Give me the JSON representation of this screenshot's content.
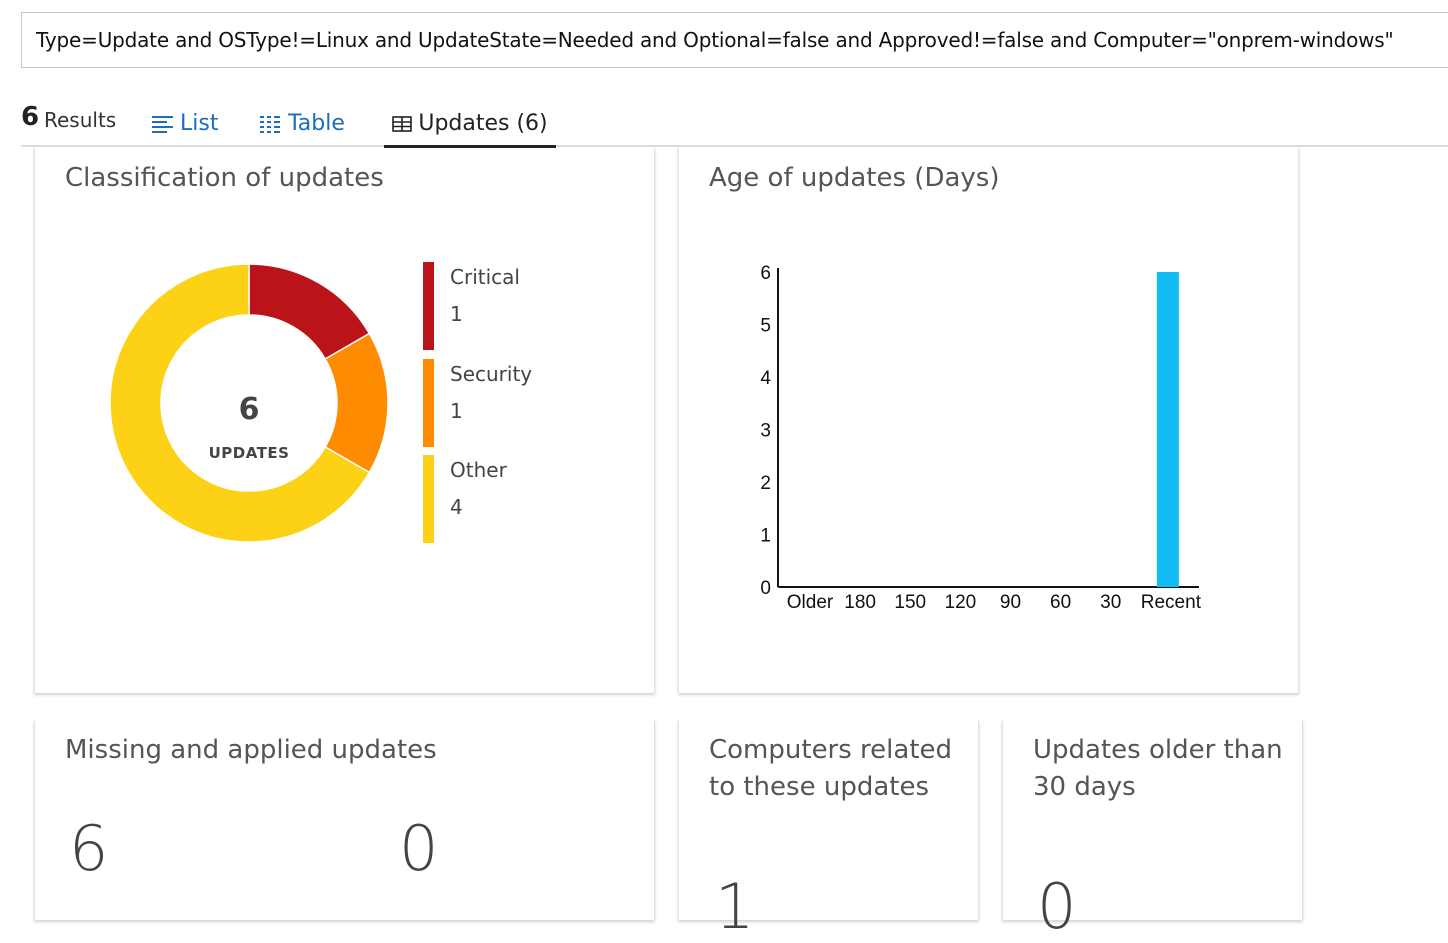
{
  "query": {
    "text": "Type=Update and OSType!=Linux and UpdateState=Needed and Optional=false and Approved!=false and Computer=\"onprem-windows\""
  },
  "results": {
    "count": "6",
    "label": "Results"
  },
  "tabs": {
    "list": "List",
    "table": "Table",
    "updates": "Updates (6)"
  },
  "classification": {
    "title": "Classification of updates",
    "center_value": "6",
    "center_label": "UPDATES",
    "items": [
      {
        "name": "Critical",
        "count": "1",
        "color": "#ba141a"
      },
      {
        "name": "Security",
        "count": "1",
        "color": "#ff8c00"
      },
      {
        "name": "Other",
        "count": "4",
        "color": "#fcd116"
      }
    ]
  },
  "age": {
    "title": "Age of updates (Days)"
  },
  "chart_data": {
    "type": "bar",
    "title": "Age of updates (Days)",
    "categories": [
      "Older",
      "180",
      "150",
      "120",
      "90",
      "60",
      "30",
      "Recent"
    ],
    "values": [
      0,
      0,
      0,
      0,
      0,
      0,
      0,
      6
    ],
    "yticks": [
      "0",
      "1",
      "2",
      "3",
      "4",
      "5",
      "6"
    ],
    "ylim": [
      0,
      6
    ],
    "bar_color": "#12bcf2"
  },
  "missing_applied": {
    "title": "Missing and applied updates",
    "missing": "6",
    "applied": "0"
  },
  "computers": {
    "title_line1": "Computers related",
    "title_line2": "to these updates",
    "value": "1"
  },
  "older": {
    "title_line1": "Updates older than",
    "title_line2": "30 days",
    "value": "0"
  }
}
